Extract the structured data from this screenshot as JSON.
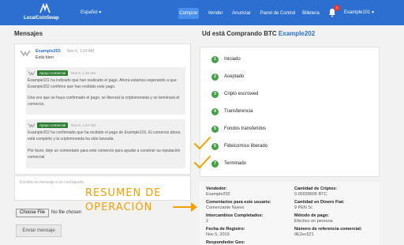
{
  "header": {
    "logo_text": "LocalCoinSwap",
    "language": "Español",
    "nav": [
      "Comprar",
      "Vender",
      "Anunciar",
      "Panel de Control",
      "Billetera"
    ],
    "notifications": "4",
    "username": "Example101",
    "accent": "#2c6fd1"
  },
  "messages": {
    "title": "Mensajes",
    "first": {
      "user": "Example202",
      "time": "Nov 6, 1:14 AM",
      "text": "Está bien"
    },
    "sys1": {
      "tag": "Apoyo comercial",
      "time": "Nov 6, 1:16 AM",
      "p1": "Example101 ha indicado que han realizado el pago. Ahora estamos esperando a que Example202 confirme que han recibido este pago.",
      "p2": "Una vez que se haya confirmado el pago, se liberará la criptomoneda y se terminará el comercio."
    },
    "sys2": {
      "tag": "Apoyo comercial",
      "time": "Nov 6, 1:22 AM",
      "p1": "Example202 ha confirmado que ha recibido el pago de Example101. El comercio ahora está completo y la criptomoneda ha sido lanzada.",
      "p2": "Por favor, deje un comentario para este comercio para ayudar a construir su reputación comercial"
    },
    "compose_placeholder": "Escriba un mensaje a su contraparte",
    "file_button": "Choose File",
    "file_status": "No file chosen",
    "send_button": "Enviar mensaje"
  },
  "trade": {
    "title": "Ud está Comprando BTC",
    "counterparty": "Example202",
    "steps": [
      {
        "num": "1",
        "label": "Iniciado"
      },
      {
        "num": "2",
        "label": "Aceptado"
      },
      {
        "num": "3",
        "label": "Cripto escrowed"
      },
      {
        "num": "4",
        "label": "Transferencia"
      },
      {
        "num": "5",
        "label": "Fondos transferidos"
      },
      {
        "num": "6",
        "label": "Fideicomiso liberado"
      },
      {
        "num": "7",
        "label": "Terminado"
      }
    ],
    "summary": {
      "vendor_label": "Vendedor:",
      "vendor": "Example202",
      "comments_label": "Comentarios para este usuario:",
      "comments": "Comerciante Nuevo",
      "trades_label": "Intercambios Completados:",
      "trades": "2",
      "reg_label": "Fecha de Registro:",
      "reg": "Nov 5, 2019",
      "resp_label": "Respondedor Geo:",
      "crypto_label": "Cantidad de Criptos:",
      "crypto": "0.00028605 BTC",
      "fiat_label": "Cantidad en Dinero Fiat:",
      "fiat": "9 PEN S/.",
      "method_label": "Método de pago:",
      "method": "Efectivo en persona",
      "ref_label": "Número de referencia comercial:",
      "ref": "9E2ec521"
    }
  },
  "annotation": {
    "line1": "RESUMEN DE",
    "line2": "OPERACIÓN",
    "color": "#f2a000"
  }
}
